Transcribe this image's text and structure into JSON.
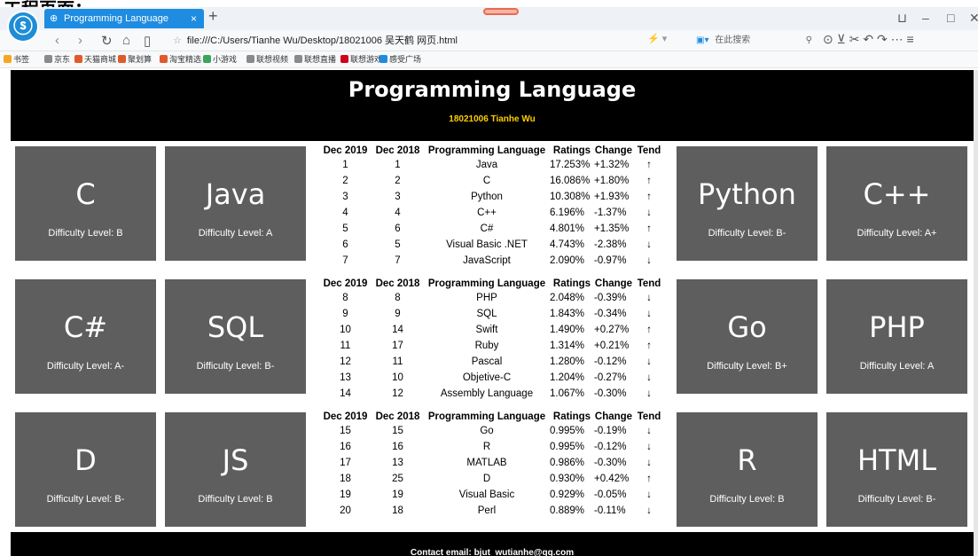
{
  "caption": "工程页面：",
  "browser": {
    "tab_title": "Programming Language",
    "tab_close": "×",
    "new_tab": "+",
    "url": "file:///C:/Users/Tianhe Wu/Desktop/18021006 吴天鹤 网页.html",
    "search_placeholder": "在此搜索",
    "nav": {
      "back": "‹",
      "forward": "›",
      "reload": "↻",
      "home": "⌂",
      "reader": "▯"
    },
    "window": {
      "restore": "⊔",
      "minimize": "–",
      "maximize": "□",
      "close": "✕"
    },
    "tools": "⊙ ⊻ ✂ ↶ ↷ ⋯ ≡",
    "bookmarks": [
      {
        "label": "书签",
        "color": "#f5a623"
      },
      {
        "label": "京东",
        "color": "#8a8a8a"
      },
      {
        "label": "天猫商城",
        "color": "#e05a2b"
      },
      {
        "label": "聚划算",
        "color": "#e05a2b"
      },
      {
        "label": "淘宝精选",
        "color": "#e05a2b"
      },
      {
        "label": "小游戏",
        "color": "#3ba55c"
      },
      {
        "label": "联想视频",
        "color": "#8a8a8a"
      },
      {
        "label": "联想直播",
        "color": "#8a8a8a"
      },
      {
        "label": "联想游戏",
        "color": "#d0021b"
      },
      {
        "label": "感受广场",
        "color": "#1e8ce0"
      }
    ]
  },
  "page": {
    "title": "Programming Language",
    "subtitle": "18021006 Tianhe Wu",
    "footer": "Contact email: bjut_wutianhe@qq.com"
  },
  "cards": [
    {
      "lang": "C",
      "diff": "Difficulty Level: B"
    },
    {
      "lang": "Java",
      "diff": "Difficulty Level: A"
    },
    {
      "lang": "Python",
      "diff": "Difficulty Level: B-"
    },
    {
      "lang": "C++",
      "diff": "Difficulty Level: A+"
    },
    {
      "lang": "C#",
      "diff": "Difficulty Level: A-"
    },
    {
      "lang": "SQL",
      "diff": "Difficulty Level: B-"
    },
    {
      "lang": "Go",
      "diff": "Difficulty Level: B+"
    },
    {
      "lang": "PHP",
      "diff": "Difficulty Level: A"
    },
    {
      "lang": "D",
      "diff": "Difficulty Level: B-"
    },
    {
      "lang": "JS",
      "diff": "Difficulty Level: B"
    },
    {
      "lang": "R",
      "diff": "Difficulty Level: B"
    },
    {
      "lang": "HTML",
      "diff": "Difficulty Level: B-"
    }
  ],
  "table_headers": [
    "Dec 2019",
    "Dec 2018",
    "Programming Language",
    "Ratings",
    "Change",
    "Tend"
  ],
  "tables": [
    [
      [
        "1",
        "1",
        "Java",
        "17.253%",
        "+1.32%",
        "↑"
      ],
      [
        "2",
        "2",
        "C",
        "16.086%",
        "+1.80%",
        "↑"
      ],
      [
        "3",
        "3",
        "Python",
        "10.308%",
        "+1.93%",
        "↑"
      ],
      [
        "4",
        "4",
        "C++",
        "6.196%",
        "-1.37%",
        "↓"
      ],
      [
        "5",
        "6",
        "C#",
        "4.801%",
        "+1.35%",
        "↑"
      ],
      [
        "6",
        "5",
        "Visual Basic .NET",
        "4.743%",
        "-2.38%",
        "↓"
      ],
      [
        "7",
        "7",
        "JavaScript",
        "2.090%",
        "-0.97%",
        "↓"
      ]
    ],
    [
      [
        "8",
        "8",
        "PHP",
        "2.048%",
        "-0.39%",
        "↓"
      ],
      [
        "9",
        "9",
        "SQL",
        "1.843%",
        "-0.34%",
        "↓"
      ],
      [
        "10",
        "14",
        "Swift",
        "1.490%",
        "+0.27%",
        "↑"
      ],
      [
        "11",
        "17",
        "Ruby",
        "1.314%",
        "+0.21%",
        "↑"
      ],
      [
        "12",
        "11",
        "Pascal",
        "1.280%",
        "-0.12%",
        "↓"
      ],
      [
        "13",
        "10",
        "Objetive-C",
        "1.204%",
        "-0.27%",
        "↓"
      ],
      [
        "14",
        "12",
        "Assembly Language",
        "1.067%",
        "-0.30%",
        "↓"
      ]
    ],
    [
      [
        "15",
        "15",
        "Go",
        "0.995%",
        "-0.19%",
        "↓"
      ],
      [
        "16",
        "16",
        "R",
        "0.995%",
        "-0.12%",
        "↓"
      ],
      [
        "17",
        "13",
        "MATLAB",
        "0.986%",
        "-0.30%",
        "↓"
      ],
      [
        "18",
        "25",
        "D",
        "0.930%",
        "+0.42%",
        "↑"
      ],
      [
        "19",
        "19",
        "Visual Basic",
        "0.929%",
        "-0.05%",
        "↓"
      ],
      [
        "20",
        "18",
        "Perl",
        "0.889%",
        "-0.11%",
        "↓"
      ]
    ]
  ]
}
